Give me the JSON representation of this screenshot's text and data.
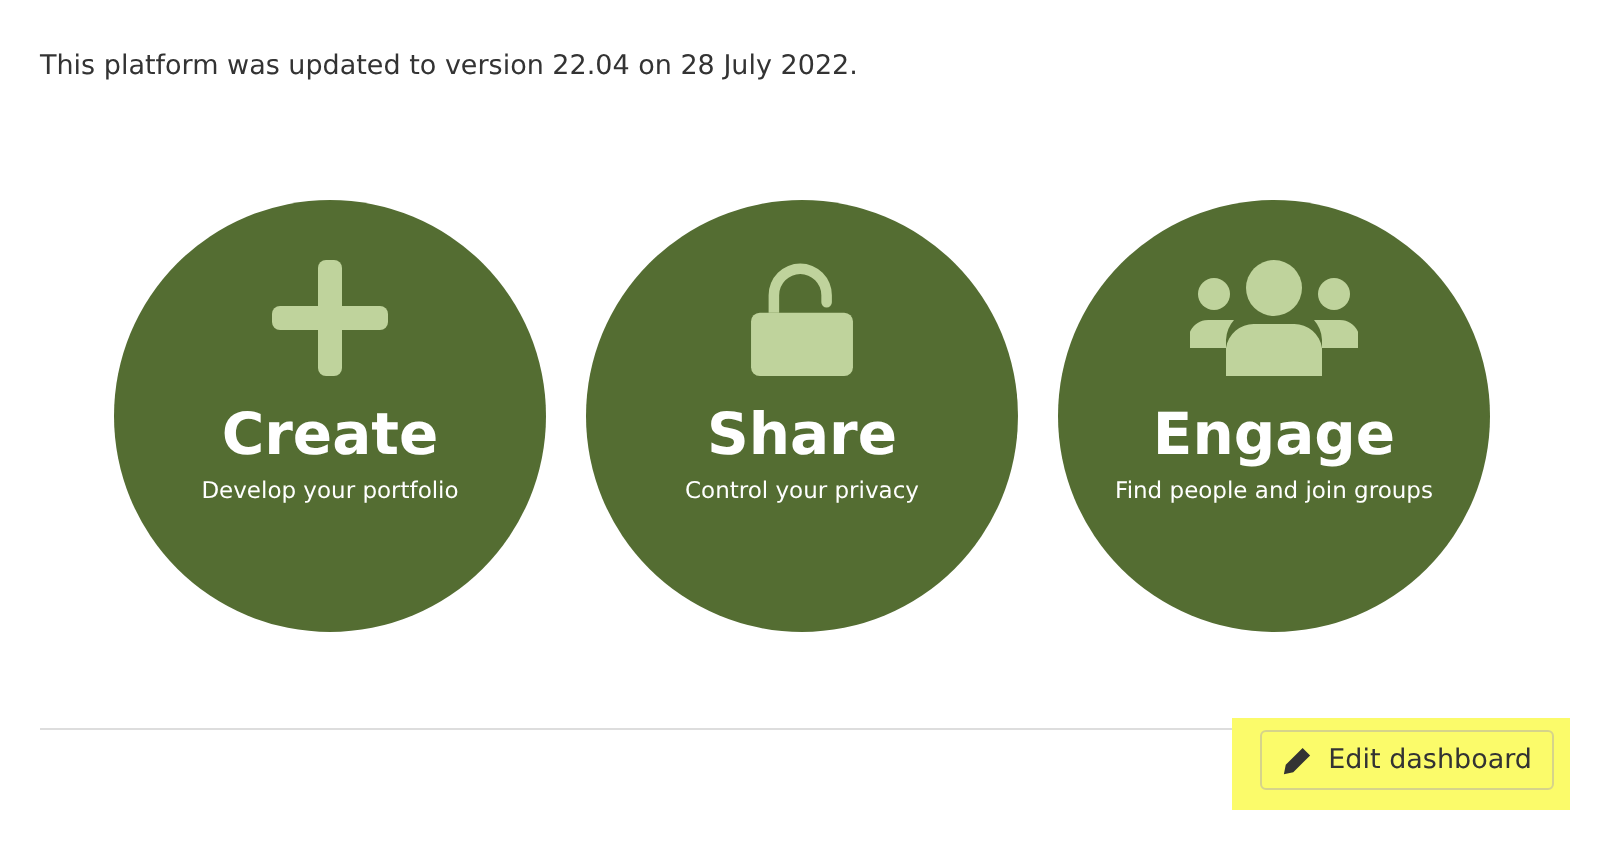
{
  "notice": "This platform was updated to version 22.04 on 28 July 2022.",
  "cards": [
    {
      "kind": "create",
      "title": "Create",
      "subtitle": "Develop your portfolio"
    },
    {
      "kind": "share",
      "title": "Share",
      "subtitle": "Control your privacy"
    },
    {
      "kind": "engage",
      "title": "Engage",
      "subtitle": "Find people and join groups"
    }
  ],
  "edit_button": {
    "label": "Edit dashboard",
    "highlighted": true
  }
}
